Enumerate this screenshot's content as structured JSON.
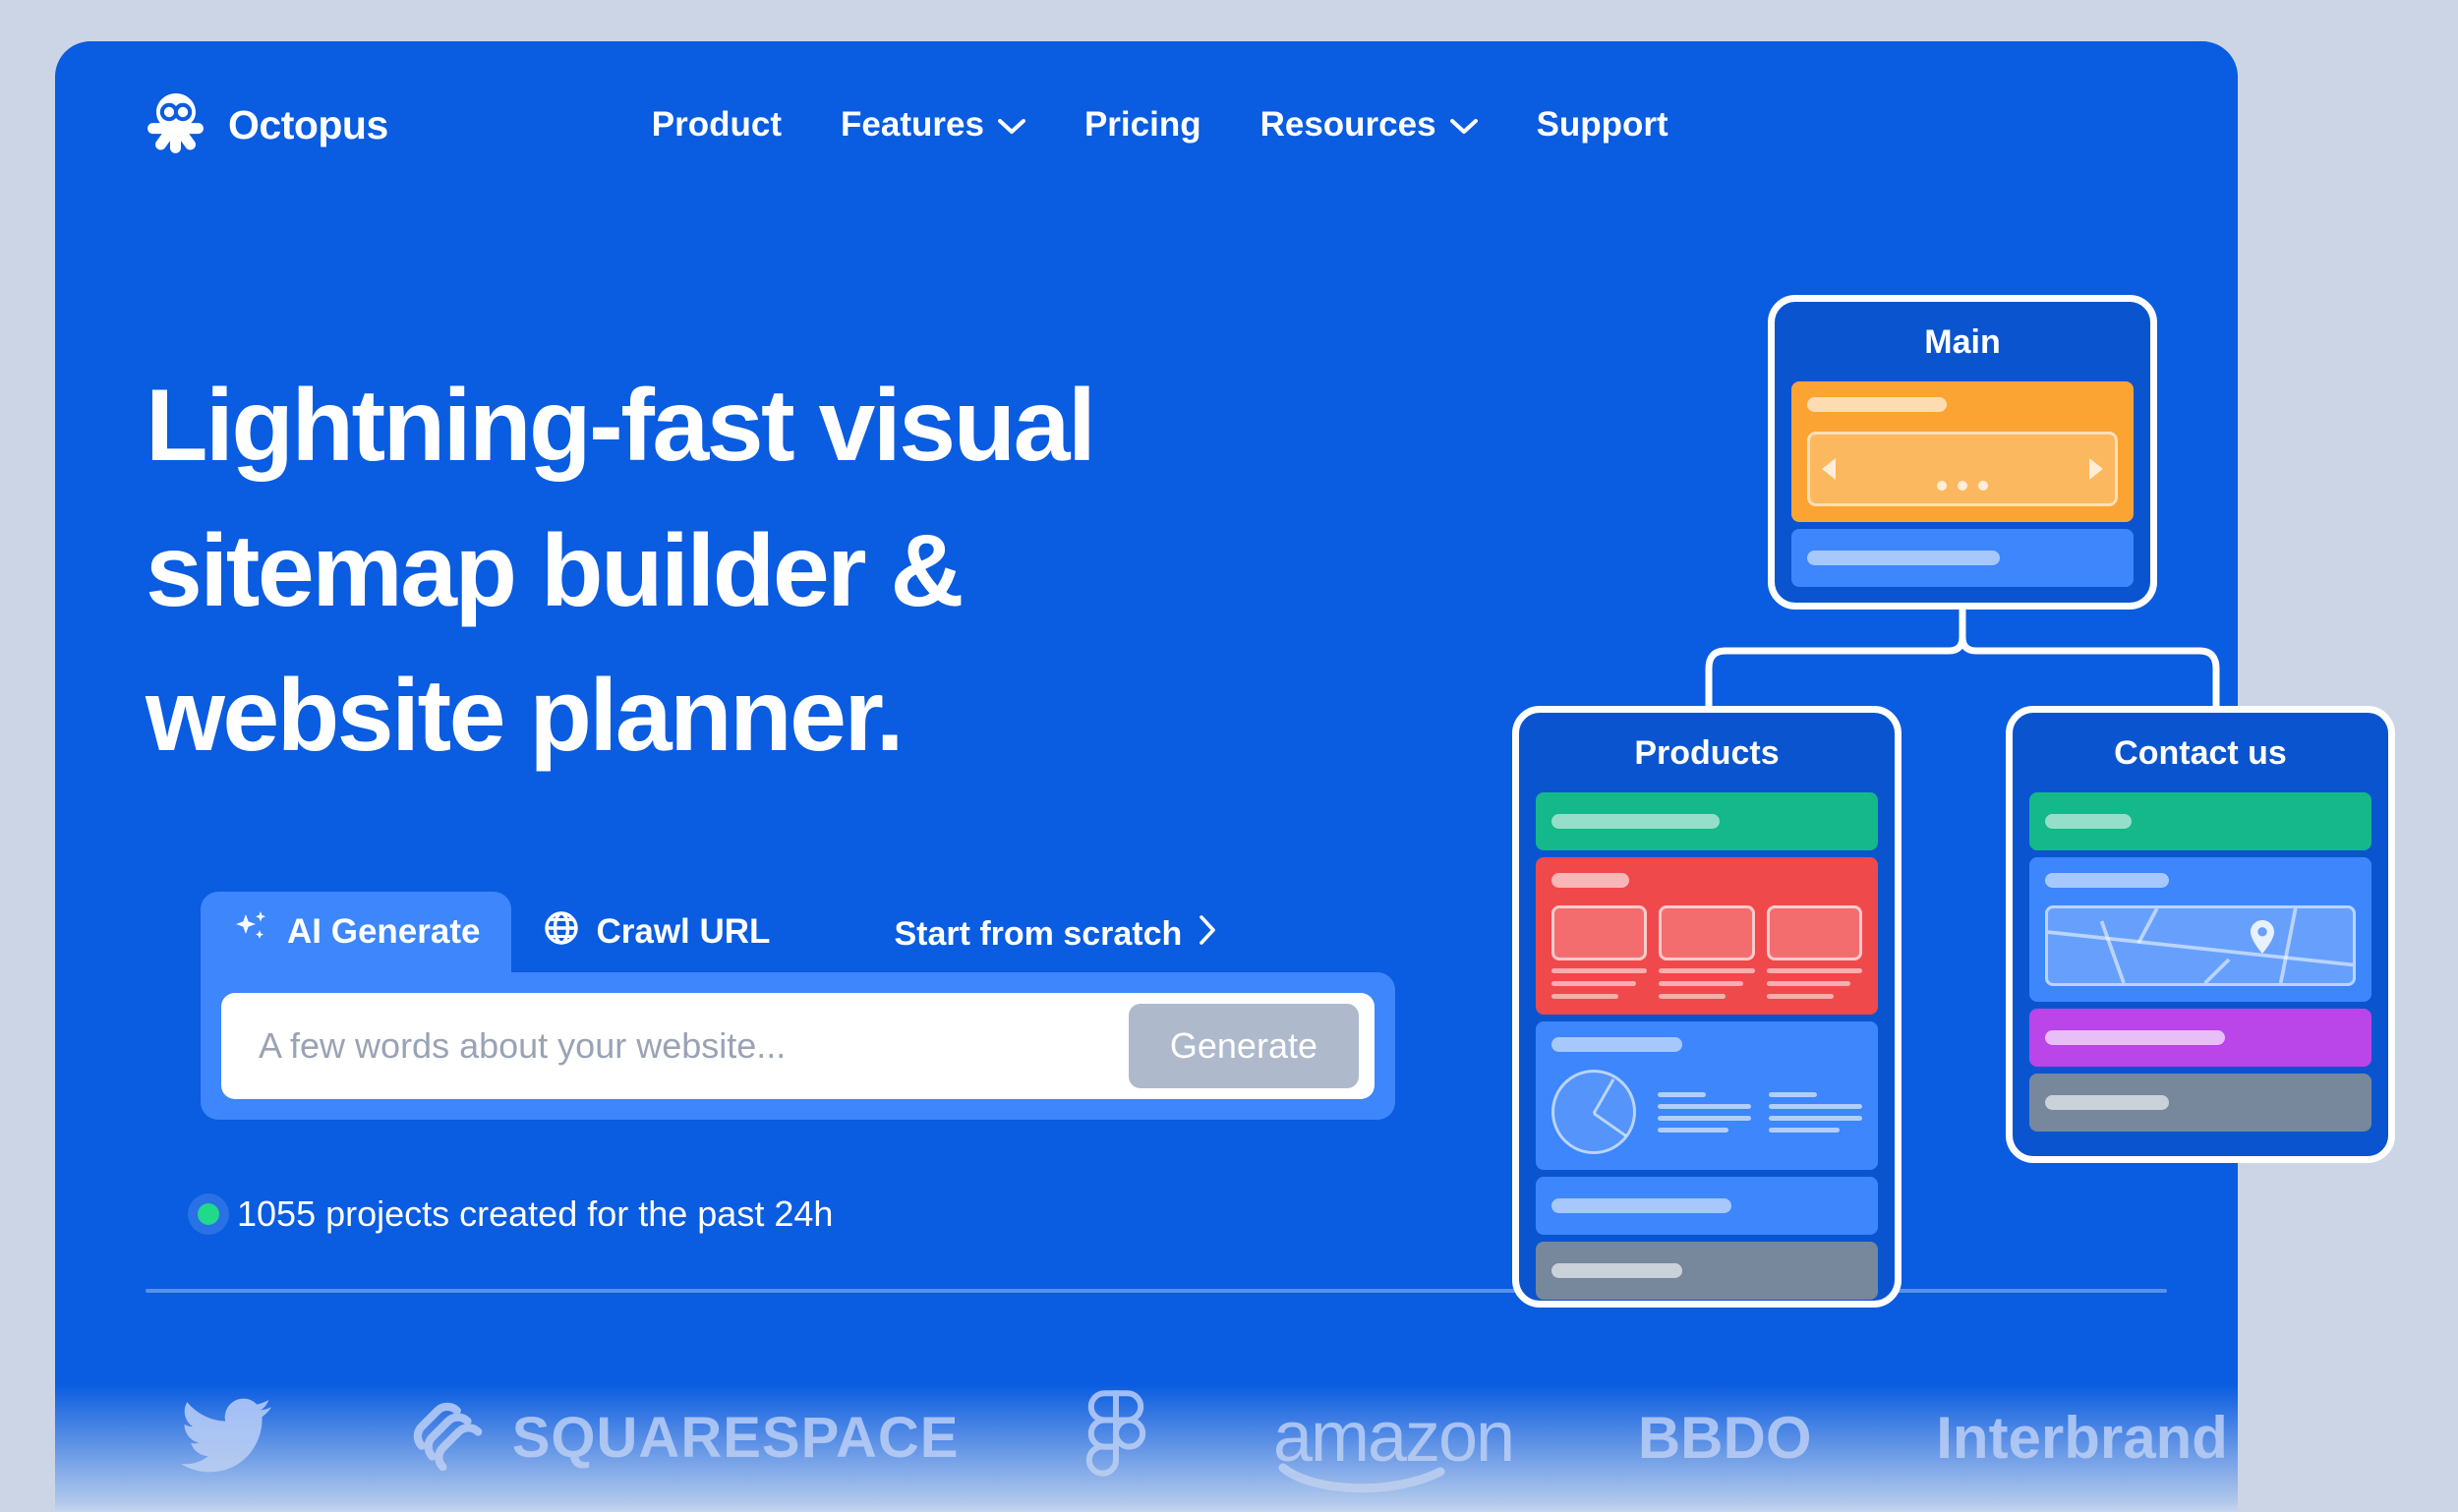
{
  "brand": {
    "name": "Octopus",
    "logo_icon": "octopus-logo-icon"
  },
  "nav": {
    "items": [
      {
        "label": "Product",
        "has_chevron": false
      },
      {
        "label": "Features",
        "has_chevron": true,
        "chevron": "⌄"
      },
      {
        "label": "Pricing",
        "has_chevron": false
      },
      {
        "label": "Resources",
        "has_chevron": true,
        "chevron": "⌄"
      },
      {
        "label": "Support",
        "has_chevron": false
      }
    ]
  },
  "hero": {
    "headline_line1": "Lightning-fast visual",
    "headline_line2": "sitemap builder &",
    "headline_line3": "website planner."
  },
  "generator": {
    "tabs": [
      {
        "label": "AI Generate",
        "icon": "sparkle-icon",
        "active": true
      },
      {
        "label": "Crawl URL",
        "icon": "globe-icon",
        "active": false
      }
    ],
    "start_from_scratch": {
      "label": "Start from scratch",
      "chevron": "›"
    },
    "input": {
      "value": "",
      "placeholder": "A few words about your website..."
    },
    "generate_button": {
      "label": "Generate"
    }
  },
  "stat": {
    "text": "1055 projects created for the past 24h",
    "dot_color": "#21d98a"
  },
  "logos": [
    {
      "name": "twitter-logo",
      "label": ""
    },
    {
      "name": "squarespace-logo",
      "label": "SQUARESPACE"
    },
    {
      "name": "figma-logo",
      "label": ""
    },
    {
      "name": "amazon-logo",
      "label": "amazon"
    },
    {
      "name": "bbdo-logo",
      "label": "BBDO"
    },
    {
      "name": "interbrand-logo",
      "label": "Interbrand"
    }
  ],
  "sitemap": {
    "nodes": [
      {
        "id": "main",
        "title": "Main",
        "blocks": [
          "orange-hero-carousel",
          "lightblue-bar"
        ]
      },
      {
        "id": "products",
        "title": "Products",
        "blocks": [
          "green-bar",
          "red-three-cards",
          "blue-pie-chart",
          "blue-bar",
          "gray-bar"
        ]
      },
      {
        "id": "contact",
        "title": "Contact us",
        "blocks": [
          "green-bar",
          "blue-map",
          "purple-bar",
          "gray-bar"
        ]
      }
    ]
  },
  "colors": {
    "page_background": "#ccd5e6",
    "hero_background": "#0a5ce0",
    "node_background": "#0a55cf",
    "accent_light_blue": "#3d86fb",
    "orange": "#fca433",
    "green": "#14b88a",
    "red": "#f0494c",
    "purple": "#ba45e8",
    "gray": "#77879c",
    "generate_button": "#aeb9cb"
  }
}
